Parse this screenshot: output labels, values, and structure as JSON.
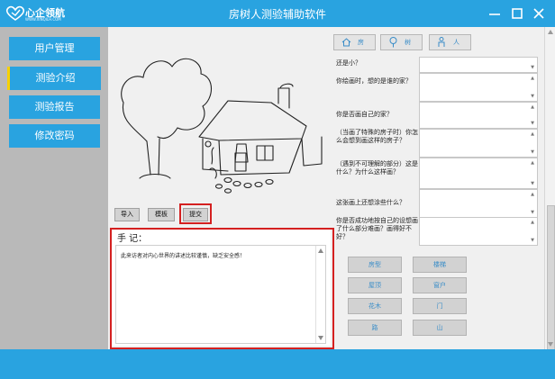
{
  "app": {
    "logo_text": "心企领航",
    "logo_sub": "WWW.XINQILH.COM",
    "title": "房树人测验辅助软件"
  },
  "window": {
    "minimize_icon": "minimize-icon",
    "maximize_icon": "maximize-icon",
    "close_icon": "close-icon"
  },
  "sidebar": {
    "items": [
      {
        "label": "用户管理",
        "active": false
      },
      {
        "label": "测验介绍",
        "active": true
      },
      {
        "label": "测验报告",
        "active": false
      },
      {
        "label": "修改密码",
        "active": false
      }
    ]
  },
  "toolbar": {
    "import_label": "导入",
    "template_label": "模板",
    "submit_label": "提交"
  },
  "notes": {
    "title": "手 记：",
    "text": "此来访者对内心世界的讲述比较谨慎，缺乏安全感！"
  },
  "tabs": [
    {
      "icon": "house-icon",
      "label": "房"
    },
    {
      "icon": "tree-icon",
      "label": "树"
    },
    {
      "icon": "person-icon",
      "label": "人"
    }
  ],
  "questions": [
    "还是小？",
    "你绘画时，想的是谁的家？",
    "你是否画自己的家？",
    "（当画了特殊的房子时）你怎么会想到画这样的房子？",
    "（遇到不可理解的部分）这是什么？为什么这样画？",
    "这张画上还想涂些什么？",
    "你是否成功地按自己的设想画了什么部分难画？画得好不好？"
  ],
  "keywords": [
    "房型",
    "楼梯",
    "屋顶",
    "窗户",
    "花木",
    "门",
    "路",
    "山"
  ],
  "colors": {
    "brand": "#29a3e0",
    "sidebar_bg": "#b9b9b9",
    "highlight": "#d42020",
    "active_marker": "#f7d000"
  }
}
